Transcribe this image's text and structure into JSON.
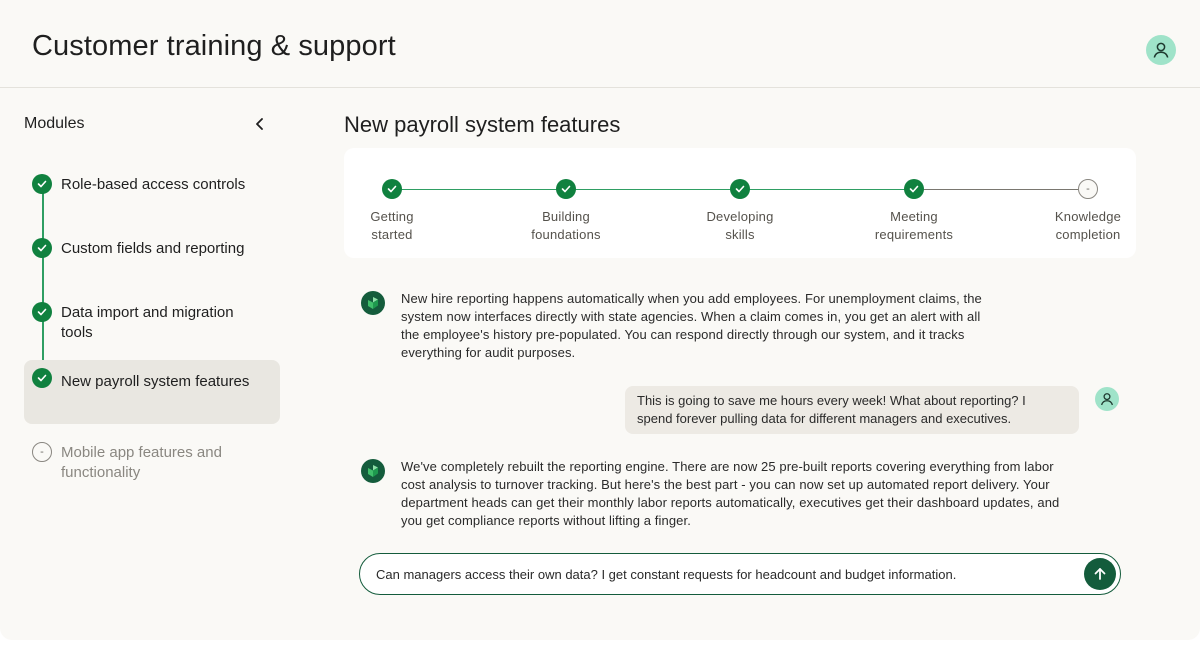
{
  "header": {
    "title": "Customer training & support",
    "avatar_icon": "user-icon"
  },
  "sidebar": {
    "title": "Modules",
    "collapse_icon": "chevron-left-icon",
    "modules": [
      {
        "label": "Role-based access controls",
        "status": "complete"
      },
      {
        "label": "Custom fields and reporting",
        "status": "complete"
      },
      {
        "label": "Data import and migration tools",
        "status": "complete"
      },
      {
        "label": "New payroll system features",
        "status": "complete",
        "active": true
      },
      {
        "label": "Mobile app features and functionality",
        "status": "pending",
        "pending_mark": "-"
      }
    ]
  },
  "main": {
    "title": "New payroll system features",
    "steps": [
      {
        "line1": "Getting",
        "line2": "started",
        "status": "complete"
      },
      {
        "line1": "Building",
        "line2": "foundations",
        "status": "complete"
      },
      {
        "line1": "Developing",
        "line2": "skills",
        "status": "complete"
      },
      {
        "line1": "Meeting",
        "line2": "requirements",
        "status": "complete"
      },
      {
        "line1": "Knowledge",
        "line2": "completion",
        "status": "pending",
        "pending_mark": "-"
      }
    ],
    "messages": [
      {
        "role": "assistant",
        "lines": [
          "New hire reporting happens automatically when you add employees. For unemployment claims, the",
          "system now interfaces directly with state agencies. When a claim comes in, you get an alert with all",
          "the employee's history pre-populated. You can respond directly through our system, and it tracks",
          "everything for audit purposes."
        ]
      },
      {
        "role": "user",
        "lines": [
          "This is going to save me hours every week! What about reporting? I",
          "spend forever pulling data for different managers and executives."
        ]
      },
      {
        "role": "assistant",
        "lines": [
          "We've completely rebuilt the reporting engine. There are now 25 pre-built reports covering everything from labor",
          "cost analysis to turnover tracking. But here's the best part - you can now set up automated report delivery. Your",
          "department heads can get their monthly labor reports automatically, executives get their dashboard updates, and",
          "you get compliance reports without lifting a finger."
        ]
      }
    ],
    "composer": {
      "value": "Can managers access their own data? I get constant requests for headcount and budget information.",
      "send_icon": "arrow-up-icon"
    }
  },
  "colors": {
    "accent": "#10813f",
    "accent_dark": "#145c3c",
    "avatar_bg": "#9fe3c9",
    "active_bg": "#e9e7e1",
    "page_bg": "#faf9f6"
  }
}
